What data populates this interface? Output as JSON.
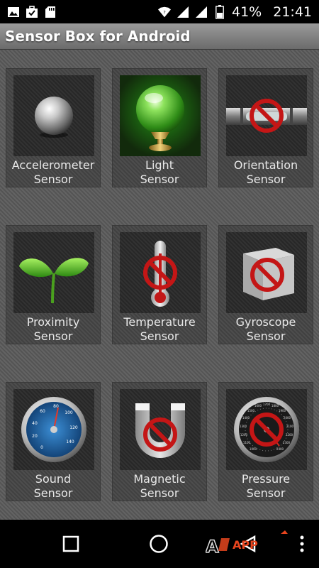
{
  "status_bar": {
    "battery_percent": "41%",
    "time": "21:41",
    "left_icons": [
      "image-icon",
      "briefcase-icon",
      "sd-card-icon"
    ],
    "right_icons": [
      "wifi-icon",
      "signal-icon",
      "signal-icon",
      "battery-icon"
    ]
  },
  "app": {
    "title": "Sensor Box for Android"
  },
  "sensors": [
    {
      "line1": "Accelerometer",
      "line2": "Sensor",
      "icon": "metal-ball-icon",
      "available": true
    },
    {
      "line1": "Light",
      "line2": "Sensor",
      "icon": "green-crystal-ball-icon",
      "available": true
    },
    {
      "line1": "Orientation",
      "line2": "Sensor",
      "icon": "spirit-level-icon",
      "available": false
    },
    {
      "line1": "Proximity",
      "line2": "Sensor",
      "icon": "sprout-icon",
      "available": true
    },
    {
      "line1": "Temperature",
      "line2": "Sensor",
      "icon": "thermometer-icon",
      "available": false
    },
    {
      "line1": "Gyroscope",
      "line2": "Sensor",
      "icon": "cube-icon",
      "available": false
    },
    {
      "line1": "Sound",
      "line2": "Sensor",
      "icon": "sound-meter-icon",
      "available": true
    },
    {
      "line1": "Magnetic",
      "line2": "Sensor",
      "icon": "magnet-icon",
      "available": false
    },
    {
      "line1": "Pressure",
      "line2": "Sensor",
      "icon": "pressure-gauge-icon",
      "available": false
    }
  ],
  "sound_gauge": {
    "ticks": [
      "0",
      "20",
      "40",
      "60",
      "80",
      "100",
      "120",
      "140"
    ]
  },
  "pressure_gauge": {
    "ticks": [
      "1000",
      "1100",
      "1200",
      "1300",
      "1400",
      "1500",
      "1600",
      "1700",
      "1800",
      "1900",
      "2000",
      "2100",
      "2200",
      "2300",
      "2400"
    ]
  },
  "nav_bar": {
    "buttons": [
      "recents-square-icon",
      "home-circle-icon",
      "back-triangle-icon",
      "menu-dots-icon"
    ]
  },
  "watermark": {
    "text": "APP",
    "icon": "app-logo-icon"
  },
  "colors": {
    "status_bar": "#000000",
    "title_text": "#ffffff",
    "label_text": "#e8e8e8",
    "unavailable_sign": "#c41616",
    "light_glow": "#3ec42a"
  }
}
